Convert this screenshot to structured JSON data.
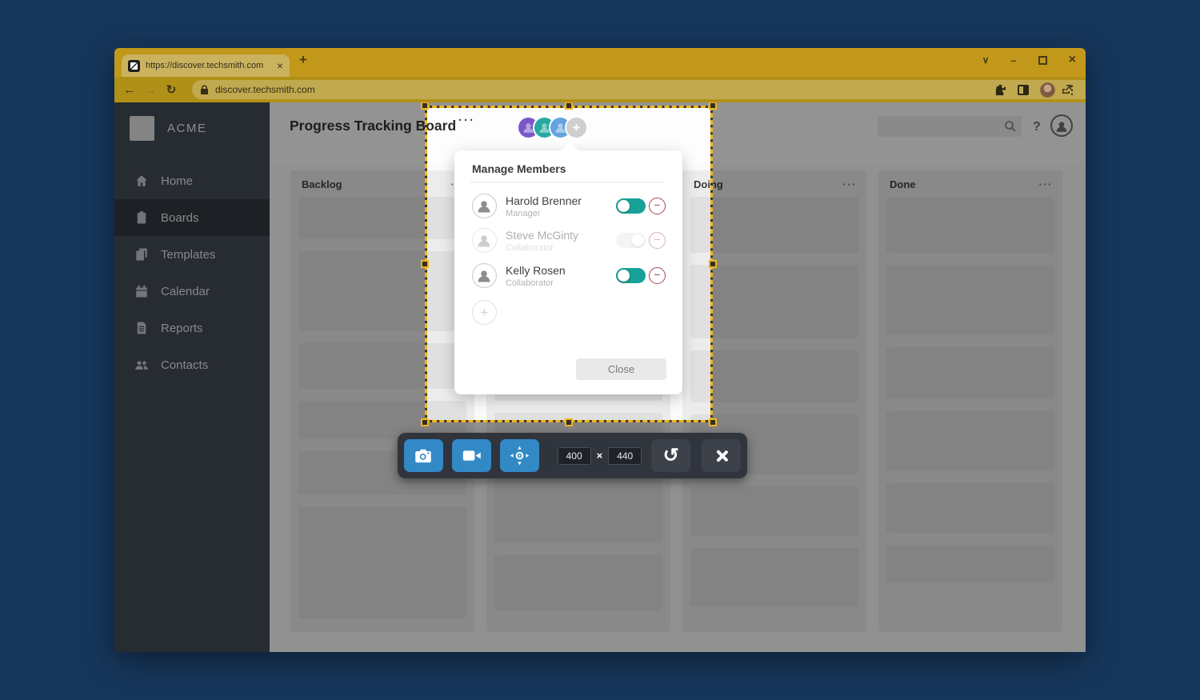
{
  "browser": {
    "tab_title": "https://discover.techsmith.com",
    "tab_close": "×",
    "new_tab": "+",
    "url": "discover.techsmith.com",
    "back": "←",
    "forward": "→",
    "reload": "↻",
    "chevron": "∨",
    "minimize": "–",
    "close": "×",
    "star": "☆",
    "kebab": "⋮",
    "theme_gold": "#c2981b"
  },
  "sidebar": {
    "logo_text": "ACME",
    "items": [
      {
        "label": "Home",
        "icon": "home-icon"
      },
      {
        "label": "Boards",
        "icon": "clipboard-icon",
        "active": true
      },
      {
        "label": "Templates",
        "icon": "templates-icon"
      },
      {
        "label": "Calendar",
        "icon": "calendar-icon"
      },
      {
        "label": "Reports",
        "icon": "report-icon"
      },
      {
        "label": "Contacts",
        "icon": "contacts-icon"
      }
    ]
  },
  "header": {
    "title": "Progress Tracking Board",
    "menu_dots": "···",
    "avatar_colors": [
      "#7a58c9",
      "#27a8a2",
      "#64a3dd"
    ],
    "add_member_label": "+",
    "help_label": "?"
  },
  "board": {
    "columns": [
      {
        "label": "Backlog",
        "dots": "···",
        "cards": [
          53,
          100,
          57,
          48,
          54,
          140
        ]
      },
      {
        "label": "",
        "dots": "···",
        "cards": [
          60,
          95,
          70,
          60,
          88,
          70
        ]
      },
      {
        "label": "Doing",
        "dots": "···",
        "cards": [
          70,
          92,
          65,
          75,
          62,
          73
        ]
      },
      {
        "label": "Done",
        "dots": "···",
        "cards": [
          70,
          88,
          65,
          75,
          62,
          48
        ]
      }
    ]
  },
  "popup": {
    "title": "Manage Members",
    "members": [
      {
        "name": "Harold Brenner",
        "role": "Manager",
        "active": true
      },
      {
        "name": "Steve McGinty",
        "role": "Collaborator",
        "active": false
      },
      {
        "name": "Kelly Rosen",
        "role": "Collaborator",
        "active": true
      }
    ],
    "add_label": "+",
    "remove_glyph": "−",
    "close_label": "Close",
    "accent_teal": "#18a099",
    "remove_color": "#a04b52"
  },
  "capture": {
    "width_value": "400",
    "height_value": "440",
    "times_label": "×",
    "selection_color": "#f0b41e",
    "button_blue": "#3389c6",
    "undo_glyph": "↺"
  }
}
